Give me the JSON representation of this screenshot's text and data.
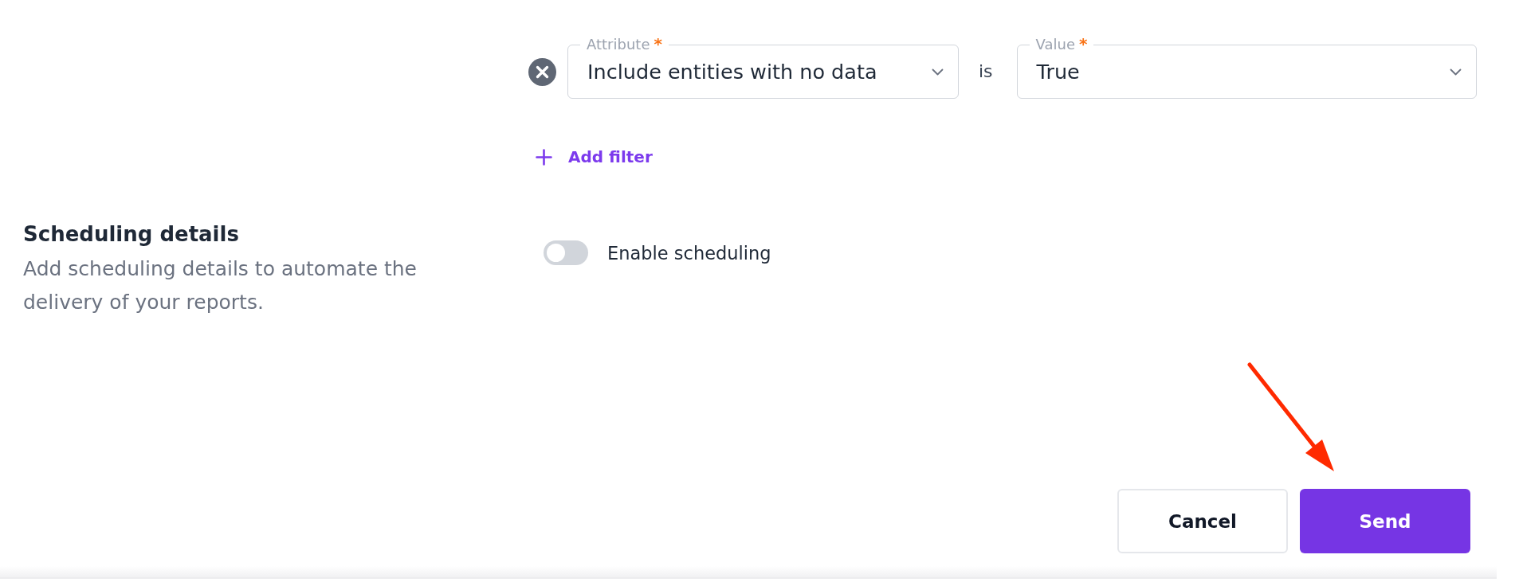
{
  "filters": [
    {
      "attribute": {
        "label": "Attribute",
        "marker": "*",
        "value": "Include entities with no data"
      },
      "operator": "is",
      "value": {
        "label": "Value",
        "marker": "*",
        "value": "True"
      }
    }
  ],
  "add_filter": {
    "label": "Add filter"
  },
  "scheduling": {
    "title": "Scheduling details",
    "description": "Add scheduling details to automate the delivery of your reports.",
    "toggle": {
      "label": "Enable scheduling",
      "on": false
    }
  },
  "actions": [
    {
      "label": "Cancel",
      "kind": "secondary"
    },
    {
      "label": "Send",
      "kind": "primary"
    }
  ],
  "annotations": [
    {
      "kind": "arrow"
    }
  ]
}
